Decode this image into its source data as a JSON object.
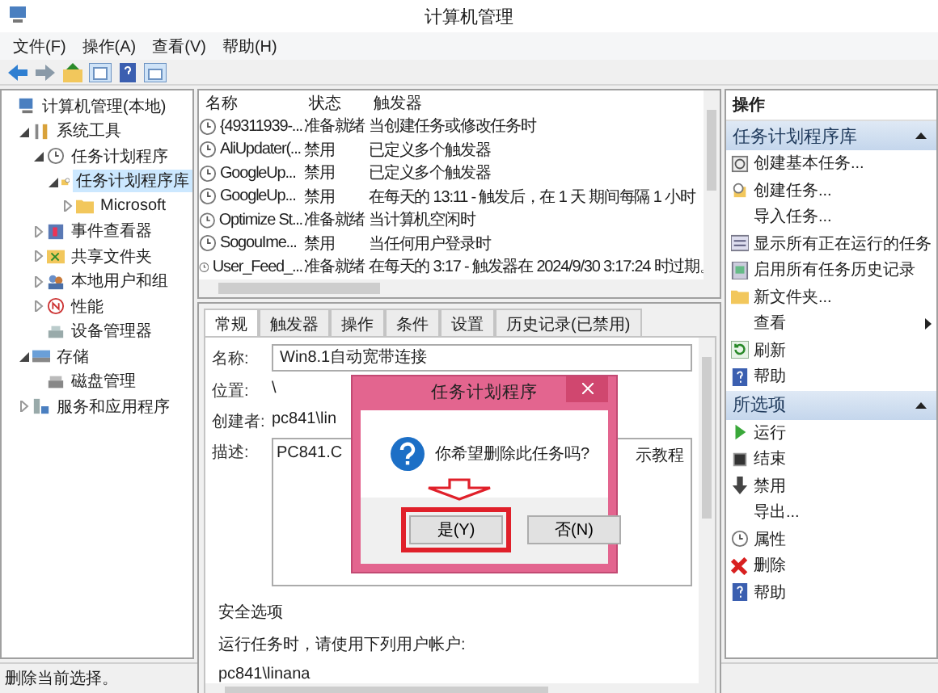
{
  "window": {
    "title": "计算机管理"
  },
  "menu": [
    "文件(F)",
    "操作(A)",
    "查看(V)",
    "帮助(H)"
  ],
  "tree": [
    {
      "label": "计算机管理(本地)",
      "kind": "computer",
      "selected": false,
      "children": [
        {
          "label": "系统工具",
          "kind": "tools",
          "expanded": true,
          "selected": false,
          "children": [
            {
              "label": "任务计划程序",
              "kind": "clock",
              "expanded": true,
              "selected": false,
              "children": [
                {
                  "label": "任务计划程序库",
                  "kind": "folder-clock",
                  "expanded": true,
                  "selected": true,
                  "children": [
                    {
                      "label": "Microsoft",
                      "kind": "folder",
                      "expanded": false,
                      "selected": false
                    }
                  ]
                }
              ]
            },
            {
              "label": "事件查看器",
              "kind": "event",
              "expanded": false,
              "selected": false
            },
            {
              "label": "共享文件夹",
              "kind": "share",
              "expanded": false,
              "selected": false
            },
            {
              "label": "本地用户和组",
              "kind": "users",
              "expanded": false,
              "selected": false
            },
            {
              "label": "性能",
              "kind": "perf",
              "expanded": false,
              "selected": false
            },
            {
              "label": "设备管理器",
              "kind": "device",
              "selected": false
            }
          ]
        },
        {
          "label": "存储",
          "kind": "storage",
          "expanded": true,
          "selected": false,
          "children": [
            {
              "label": "磁盘管理",
              "kind": "disk",
              "selected": false
            }
          ]
        },
        {
          "label": "服务和应用程序",
          "kind": "services",
          "expanded": false,
          "selected": false
        }
      ]
    }
  ],
  "task_list": {
    "columns": [
      "名称",
      "状态",
      "触发器"
    ],
    "rows": [
      {
        "name": "{49311939-...",
        "status": "准备就绪",
        "trigger": "当创建任务或修改任务时"
      },
      {
        "name": "AliUpdater(...",
        "status": "禁用",
        "trigger": "已定义多个触发器"
      },
      {
        "name": "GoogleUp...",
        "status": "禁用",
        "trigger": "已定义多个触发器"
      },
      {
        "name": "GoogleUp...",
        "status": "禁用",
        "trigger": "在每天的 13:11 - 触发后，在 1 天 期间每隔 1 小时"
      },
      {
        "name": "Optimize St...",
        "status": "准备就绪",
        "trigger": "当计算机空闲时"
      },
      {
        "name": "SogouIme...",
        "status": "禁用",
        "trigger": "当任何用户登录时"
      },
      {
        "name": "User_Feed_...",
        "status": "准备就绪",
        "trigger": "在每天的 3:17 - 触发器在 2024/9/30 3:17:24 时过期。"
      }
    ]
  },
  "details": {
    "tabs": [
      {
        "label": "常规",
        "selected": true
      },
      {
        "label": "触发器",
        "selected": false
      },
      {
        "label": "操作",
        "selected": false
      },
      {
        "label": "条件",
        "selected": false
      },
      {
        "label": "设置",
        "selected": false
      },
      {
        "label": "历史记录(已禁用)",
        "selected": false
      }
    ],
    "name_label": "名称:",
    "name_value": "Win8.1自动宽带连接",
    "location_label": "位置:",
    "location_value": "\\",
    "author_label": "创建者:",
    "author_value": "pc841\\lin",
    "description_label": "描述:",
    "description_left": "PC841.C",
    "description_right": "示教程",
    "security_title": "安全选项",
    "security_text": "运行任务时，请使用下列用户帐户:",
    "security_user": "pc841\\linana"
  },
  "dialog": {
    "title": "任务计划程序",
    "message": "你希望删除此任务吗?",
    "buttons": [
      {
        "label": "是(Y)",
        "highlighted": true
      },
      {
        "label": "否(N)",
        "highlighted": false
      }
    ]
  },
  "actions": {
    "title": "操作",
    "sections": [
      {
        "title": "任务计划程序库",
        "items": [
          {
            "label": "创建基本任务...",
            "kind": "basic-task"
          },
          {
            "label": "创建任务...",
            "kind": "create-task"
          },
          {
            "label": "导入任务...",
            "kind": "plain"
          },
          {
            "label": "显示所有正在运行的任务",
            "kind": "running"
          },
          {
            "label": "启用所有任务历史记录",
            "kind": "history"
          },
          {
            "label": "新文件夹...",
            "kind": "folder"
          },
          {
            "label": "查看",
            "kind": "submenu"
          },
          {
            "label": "刷新",
            "kind": "refresh"
          },
          {
            "label": "帮助",
            "kind": "help"
          }
        ]
      },
      {
        "title": "所选项",
        "items": [
          {
            "label": "运行",
            "kind": "run"
          },
          {
            "label": "结束",
            "kind": "stop"
          },
          {
            "label": "禁用",
            "kind": "disable"
          },
          {
            "label": "导出...",
            "kind": "plain"
          },
          {
            "label": "属性",
            "kind": "clock"
          },
          {
            "label": "删除",
            "kind": "delete"
          },
          {
            "label": "帮助",
            "kind": "help"
          }
        ]
      }
    ]
  },
  "status_bar": "删除当前选择。"
}
